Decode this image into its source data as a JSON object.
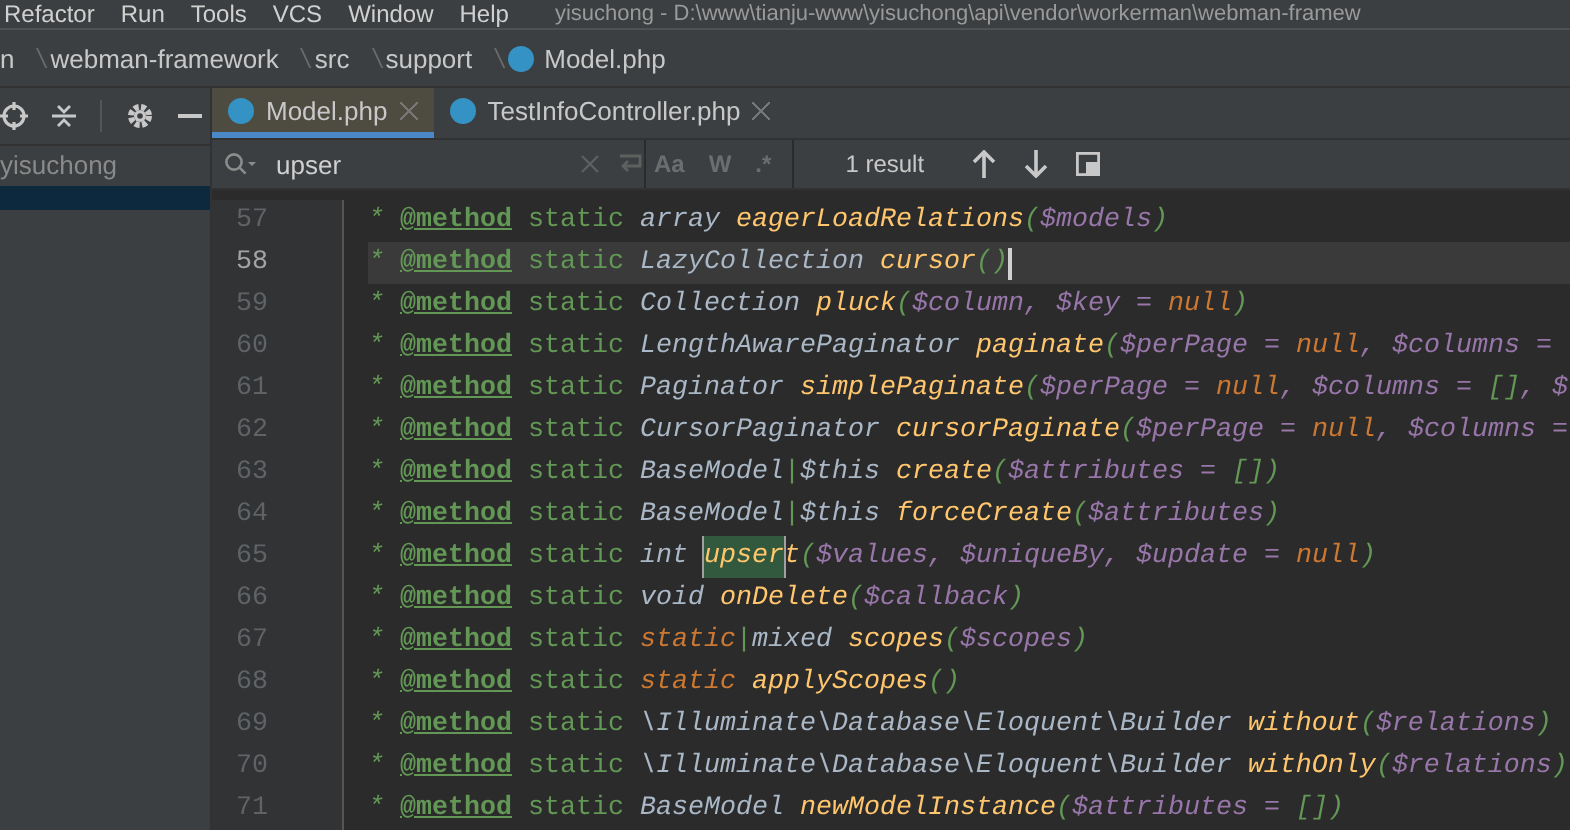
{
  "menu": [
    "Refactor",
    "Run",
    "Tools",
    "VCS",
    "Window",
    "Help"
  ],
  "window_title": "yisuchong - D:\\www\\tianju-www\\yisuchong\\api\\vendor\\workerman\\webman-framew",
  "breadcrumb": [
    {
      "label": "n",
      "file": false
    },
    {
      "label": "webman-framework",
      "file": false
    },
    {
      "label": "src",
      "file": false
    },
    {
      "label": "support",
      "file": false
    },
    {
      "label": "Model.php",
      "file": true
    }
  ],
  "sidebar": {
    "items": [
      {
        "label": "yisuchong"
      }
    ]
  },
  "tabs": [
    {
      "label": "Model.php",
      "selected": true
    },
    {
      "label": "TestInfoController.php",
      "selected": false
    }
  ],
  "search": {
    "value": "upser",
    "result": "1 result",
    "case_label": "Aa",
    "word_label": "W",
    "regex_label": ".*"
  },
  "lines": [
    {
      "n": "57",
      "current": false,
      "caret": false,
      "segs": [
        {
          "kind": "star",
          "text": "* "
        },
        {
          "kind": "tag",
          "text": "@method"
        },
        {
          "kind": "kw",
          "text": " static "
        },
        {
          "kind": "type",
          "text": "array "
        },
        {
          "kind": "func",
          "text": "eagerLoadRelations"
        },
        {
          "kind": "p",
          "text": "("
        },
        {
          "kind": "var",
          "text": "$models"
        },
        {
          "kind": "p",
          "text": ")"
        }
      ]
    },
    {
      "n": "58",
      "current": true,
      "caret": true,
      "segs": [
        {
          "kind": "star",
          "text": "* "
        },
        {
          "kind": "tag",
          "text": "@method"
        },
        {
          "kind": "kw",
          "text": " static "
        },
        {
          "kind": "type",
          "text": "LazyCollection "
        },
        {
          "kind": "func",
          "text": "cursor"
        },
        {
          "kind": "p",
          "text": "()"
        }
      ]
    },
    {
      "n": "59",
      "current": false,
      "caret": false,
      "segs": [
        {
          "kind": "star",
          "text": "* "
        },
        {
          "kind": "tag",
          "text": "@method"
        },
        {
          "kind": "kw",
          "text": " static "
        },
        {
          "kind": "type",
          "text": "Collection "
        },
        {
          "kind": "func",
          "text": "pluck"
        },
        {
          "kind": "p",
          "text": "("
        },
        {
          "kind": "var",
          "text": "$column"
        },
        {
          "kind": "op",
          "text": ", "
        },
        {
          "kind": "var",
          "text": "$key"
        },
        {
          "kind": "op",
          "text": " = "
        },
        {
          "kind": "const",
          "text": "null"
        },
        {
          "kind": "p",
          "text": ")"
        }
      ]
    },
    {
      "n": "60",
      "current": false,
      "caret": false,
      "segs": [
        {
          "kind": "star",
          "text": "* "
        },
        {
          "kind": "tag",
          "text": "@method"
        },
        {
          "kind": "kw",
          "text": " static "
        },
        {
          "kind": "type",
          "text": "LengthAwarePaginator "
        },
        {
          "kind": "func",
          "text": "paginate"
        },
        {
          "kind": "p",
          "text": "("
        },
        {
          "kind": "var",
          "text": "$perPage"
        },
        {
          "kind": "op",
          "text": " = "
        },
        {
          "kind": "const",
          "text": "null"
        },
        {
          "kind": "op",
          "text": ", "
        },
        {
          "kind": "var",
          "text": "$columns"
        },
        {
          "kind": "op",
          "text": " ="
        }
      ]
    },
    {
      "n": "61",
      "current": false,
      "caret": false,
      "segs": [
        {
          "kind": "star",
          "text": "* "
        },
        {
          "kind": "tag",
          "text": "@method"
        },
        {
          "kind": "kw",
          "text": " static "
        },
        {
          "kind": "type",
          "text": "Paginator "
        },
        {
          "kind": "func",
          "text": "simplePaginate"
        },
        {
          "kind": "p",
          "text": "("
        },
        {
          "kind": "var",
          "text": "$perPage"
        },
        {
          "kind": "op",
          "text": " = "
        },
        {
          "kind": "const",
          "text": "null"
        },
        {
          "kind": "op",
          "text": ", "
        },
        {
          "kind": "var",
          "text": "$columns"
        },
        {
          "kind": "op",
          "text": " = "
        },
        {
          "kind": "p",
          "text": "[]"
        },
        {
          "kind": "op",
          "text": ", "
        },
        {
          "kind": "var",
          "text": "$"
        }
      ]
    },
    {
      "n": "62",
      "current": false,
      "caret": false,
      "segs": [
        {
          "kind": "star",
          "text": "* "
        },
        {
          "kind": "tag",
          "text": "@method"
        },
        {
          "kind": "kw",
          "text": " static "
        },
        {
          "kind": "type",
          "text": "CursorPaginator "
        },
        {
          "kind": "func",
          "text": "cursorPaginate"
        },
        {
          "kind": "p",
          "text": "("
        },
        {
          "kind": "var",
          "text": "$perPage"
        },
        {
          "kind": "op",
          "text": " = "
        },
        {
          "kind": "const",
          "text": "null"
        },
        {
          "kind": "op",
          "text": ", "
        },
        {
          "kind": "var",
          "text": "$columns"
        },
        {
          "kind": "op",
          "text": " ="
        }
      ]
    },
    {
      "n": "63",
      "current": false,
      "caret": false,
      "segs": [
        {
          "kind": "star",
          "text": "* "
        },
        {
          "kind": "tag",
          "text": "@method"
        },
        {
          "kind": "kw",
          "text": " static "
        },
        {
          "kind": "type",
          "text": "BaseModel"
        },
        {
          "kind": "p",
          "text": "|"
        },
        {
          "kind": "type",
          "text": "$this "
        },
        {
          "kind": "func",
          "text": "create"
        },
        {
          "kind": "p",
          "text": "("
        },
        {
          "kind": "var",
          "text": "$attributes"
        },
        {
          "kind": "op",
          "text": " = "
        },
        {
          "kind": "p",
          "text": "[])"
        }
      ]
    },
    {
      "n": "64",
      "current": false,
      "caret": false,
      "segs": [
        {
          "kind": "star",
          "text": "* "
        },
        {
          "kind": "tag",
          "text": "@method"
        },
        {
          "kind": "kw",
          "text": " static "
        },
        {
          "kind": "type",
          "text": "BaseModel"
        },
        {
          "kind": "p",
          "text": "|"
        },
        {
          "kind": "type",
          "text": "$this "
        },
        {
          "kind": "func",
          "text": "forceCreate"
        },
        {
          "kind": "p",
          "text": "("
        },
        {
          "kind": "var",
          "text": "$attributes"
        },
        {
          "kind": "p",
          "text": ")"
        }
      ]
    },
    {
      "n": "65",
      "current": false,
      "caret": false,
      "segs": [
        {
          "kind": "star",
          "text": "* "
        },
        {
          "kind": "tag",
          "text": "@method"
        },
        {
          "kind": "kw",
          "text": " static "
        },
        {
          "kind": "type",
          "text": "int "
        },
        {
          "kind": "match",
          "text": "upser"
        },
        {
          "kind": "func",
          "text": "t"
        },
        {
          "kind": "p",
          "text": "("
        },
        {
          "kind": "var",
          "text": "$values"
        },
        {
          "kind": "op",
          "text": ", "
        },
        {
          "kind": "var",
          "text": "$uniqueBy"
        },
        {
          "kind": "op",
          "text": ", "
        },
        {
          "kind": "var",
          "text": "$update"
        },
        {
          "kind": "op",
          "text": " = "
        },
        {
          "kind": "const",
          "text": "null"
        },
        {
          "kind": "p",
          "text": ")"
        }
      ]
    },
    {
      "n": "66",
      "current": false,
      "caret": false,
      "segs": [
        {
          "kind": "star",
          "text": "* "
        },
        {
          "kind": "tag",
          "text": "@method"
        },
        {
          "kind": "kw",
          "text": " static "
        },
        {
          "kind": "type",
          "text": "void "
        },
        {
          "kind": "func",
          "text": "onDelete"
        },
        {
          "kind": "p",
          "text": "("
        },
        {
          "kind": "var",
          "text": "$callback"
        },
        {
          "kind": "p",
          "text": ")"
        }
      ]
    },
    {
      "n": "67",
      "current": false,
      "caret": false,
      "segs": [
        {
          "kind": "star",
          "text": "* "
        },
        {
          "kind": "tag",
          "text": "@method"
        },
        {
          "kind": "kw",
          "text": " static "
        },
        {
          "kind": "const",
          "text": "static"
        },
        {
          "kind": "p",
          "text": "|"
        },
        {
          "kind": "type",
          "text": "mixed "
        },
        {
          "kind": "func",
          "text": "scopes"
        },
        {
          "kind": "p",
          "text": "("
        },
        {
          "kind": "var",
          "text": "$scopes"
        },
        {
          "kind": "p",
          "text": ")"
        }
      ]
    },
    {
      "n": "68",
      "current": false,
      "caret": false,
      "segs": [
        {
          "kind": "star",
          "text": "* "
        },
        {
          "kind": "tag",
          "text": "@method"
        },
        {
          "kind": "kw",
          "text": " static "
        },
        {
          "kind": "const",
          "text": "static "
        },
        {
          "kind": "func",
          "text": "applyScopes"
        },
        {
          "kind": "p",
          "text": "()"
        }
      ]
    },
    {
      "n": "69",
      "current": false,
      "caret": false,
      "segs": [
        {
          "kind": "star",
          "text": "* "
        },
        {
          "kind": "tag",
          "text": "@method"
        },
        {
          "kind": "kw",
          "text": " static "
        },
        {
          "kind": "type",
          "text": "\\Illuminate\\Database\\Eloquent\\Builder "
        },
        {
          "kind": "func",
          "text": "without"
        },
        {
          "kind": "p",
          "text": "("
        },
        {
          "kind": "var",
          "text": "$relations"
        },
        {
          "kind": "p",
          "text": ")"
        }
      ]
    },
    {
      "n": "70",
      "current": false,
      "caret": false,
      "segs": [
        {
          "kind": "star",
          "text": "* "
        },
        {
          "kind": "tag",
          "text": "@method"
        },
        {
          "kind": "kw",
          "text": " static "
        },
        {
          "kind": "type",
          "text": "\\Illuminate\\Database\\Eloquent\\Builder "
        },
        {
          "kind": "func",
          "text": "withOnly"
        },
        {
          "kind": "p",
          "text": "("
        },
        {
          "kind": "var",
          "text": "$relations"
        },
        {
          "kind": "p",
          "text": ")"
        }
      ]
    },
    {
      "n": "71",
      "current": false,
      "caret": false,
      "segs": [
        {
          "kind": "star",
          "text": "* "
        },
        {
          "kind": "tag",
          "text": "@method"
        },
        {
          "kind": "kw",
          "text": " static "
        },
        {
          "kind": "type",
          "text": "BaseModel "
        },
        {
          "kind": "func",
          "text": "newModelInstance"
        },
        {
          "kind": "p",
          "text": "("
        },
        {
          "kind": "var",
          "text": "$attributes"
        },
        {
          "kind": "op",
          "text": " = "
        },
        {
          "kind": "p",
          "text": "[])"
        }
      ]
    }
  ]
}
